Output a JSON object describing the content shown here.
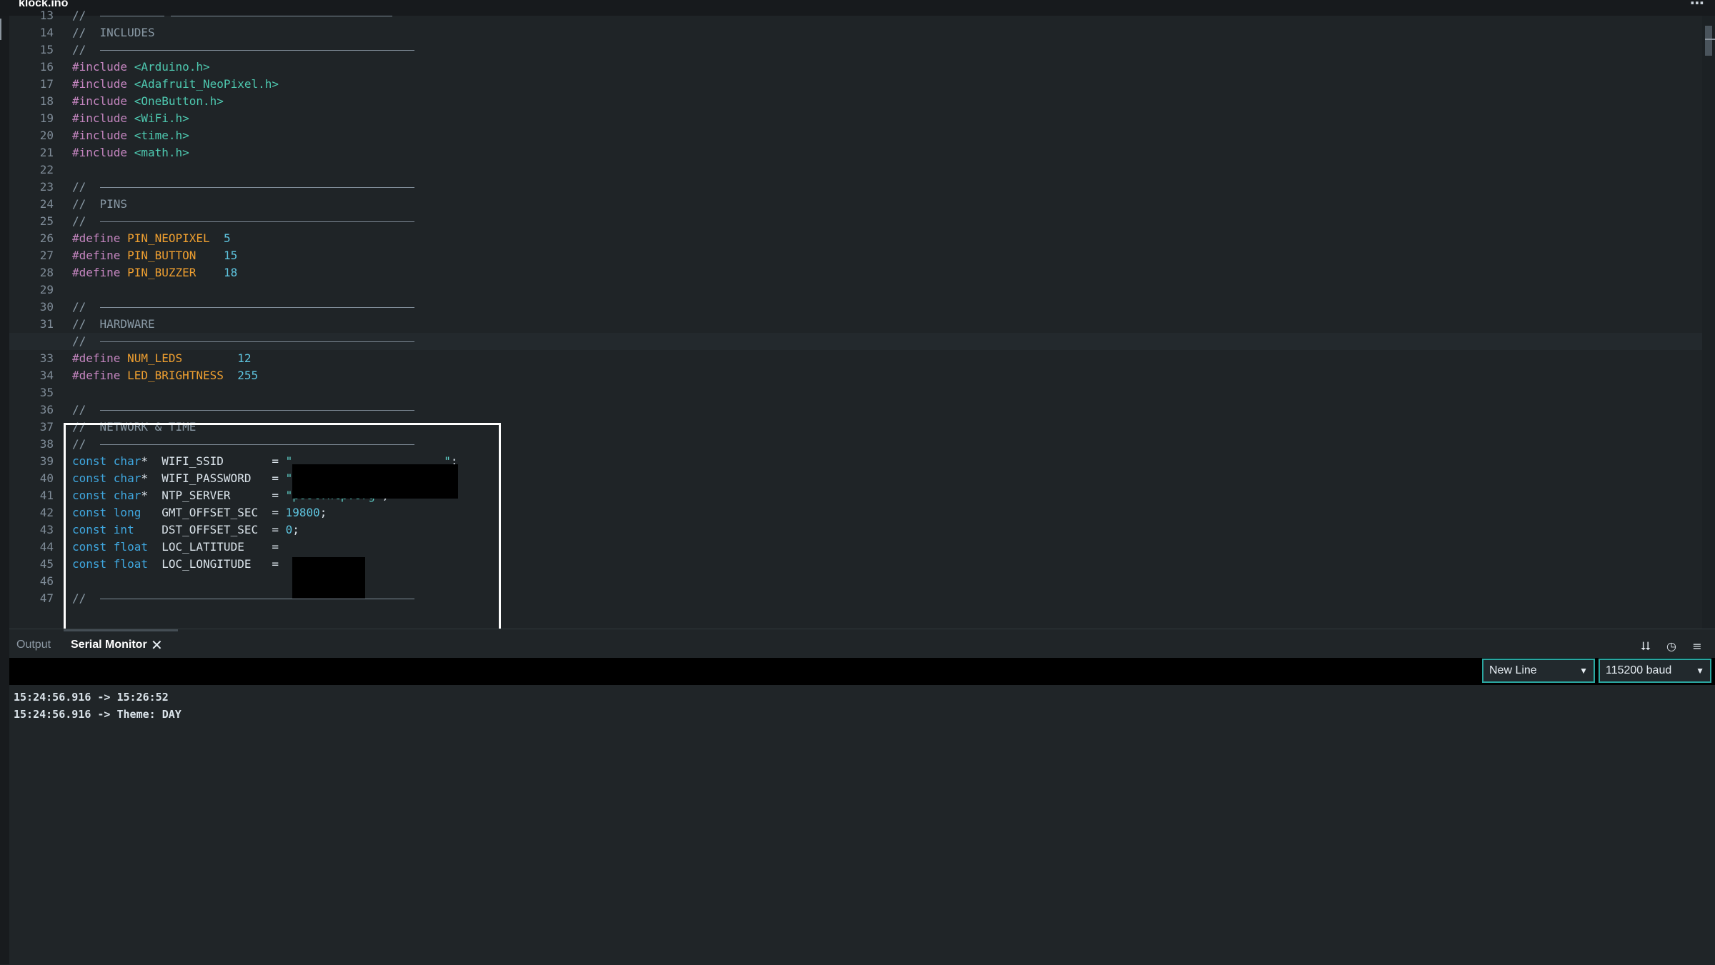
{
  "window": {
    "file_tab": "klock.ino",
    "more_icon": "ellipsis-icon"
  },
  "editor": {
    "active_line": 32,
    "lines": [
      {
        "n": "13",
        "parts": [
          [
            "cmt",
            "//  "
          ],
          [
            "rule",
            90
          ],
          [
            "plain",
            " "
          ],
          [
            "rule",
            310
          ]
        ]
      },
      {
        "n": "14",
        "parts": [
          [
            "cmt",
            "//  INCLUDES"
          ]
        ]
      },
      {
        "n": "15",
        "parts": [
          [
            "cmt",
            "//  "
          ],
          [
            "rule",
            440
          ]
        ]
      },
      {
        "n": "16",
        "parts": [
          [
            "dir",
            "#include"
          ],
          [
            "plain",
            " "
          ],
          [
            "lib",
            "<Arduino.h>"
          ]
        ]
      },
      {
        "n": "17",
        "parts": [
          [
            "dir",
            "#include"
          ],
          [
            "plain",
            " "
          ],
          [
            "lib",
            "<Adafruit_NeoPixel.h>"
          ]
        ]
      },
      {
        "n": "18",
        "parts": [
          [
            "dir",
            "#include"
          ],
          [
            "plain",
            " "
          ],
          [
            "lib",
            "<OneButton.h>"
          ]
        ]
      },
      {
        "n": "19",
        "parts": [
          [
            "dir",
            "#include"
          ],
          [
            "plain",
            " "
          ],
          [
            "lib",
            "<WiFi.h>"
          ]
        ]
      },
      {
        "n": "20",
        "parts": [
          [
            "dir",
            "#include"
          ],
          [
            "plain",
            " "
          ],
          [
            "lib",
            "<time.h>"
          ]
        ]
      },
      {
        "n": "21",
        "parts": [
          [
            "dir",
            "#include"
          ],
          [
            "plain",
            " "
          ],
          [
            "lib",
            "<math.h>"
          ]
        ]
      },
      {
        "n": "22",
        "parts": []
      },
      {
        "n": "23",
        "parts": [
          [
            "cmt",
            "//  "
          ],
          [
            "rule",
            440
          ]
        ]
      },
      {
        "n": "24",
        "parts": [
          [
            "cmt",
            "//  PINS"
          ]
        ]
      },
      {
        "n": "25",
        "parts": [
          [
            "cmt",
            "//  "
          ],
          [
            "rule",
            440
          ]
        ]
      },
      {
        "n": "26",
        "parts": [
          [
            "dir",
            "#define"
          ],
          [
            "plain",
            " "
          ],
          [
            "macro",
            "PIN_NEOPIXEL"
          ],
          [
            "plain",
            "  "
          ],
          [
            "num",
            "5"
          ]
        ]
      },
      {
        "n": "27",
        "parts": [
          [
            "dir",
            "#define"
          ],
          [
            "plain",
            " "
          ],
          [
            "macro",
            "PIN_BUTTON"
          ],
          [
            "plain",
            "    "
          ],
          [
            "num",
            "15"
          ]
        ]
      },
      {
        "n": "28",
        "parts": [
          [
            "dir",
            "#define"
          ],
          [
            "plain",
            " "
          ],
          [
            "macro",
            "PIN_BUZZER"
          ],
          [
            "plain",
            "    "
          ],
          [
            "num",
            "18"
          ]
        ]
      },
      {
        "n": "29",
        "parts": []
      },
      {
        "n": "30",
        "parts": [
          [
            "cmt",
            "//  "
          ],
          [
            "rule",
            440
          ]
        ]
      },
      {
        "n": "31",
        "parts": [
          [
            "cmt",
            "//  HARDWARE"
          ]
        ]
      },
      {
        "n": "32",
        "parts": [
          [
            "cmt",
            "//  "
          ],
          [
            "rule",
            440
          ]
        ]
      },
      {
        "n": "33",
        "parts": [
          [
            "dir",
            "#define"
          ],
          [
            "plain",
            " "
          ],
          [
            "macro",
            "NUM_LEDS"
          ],
          [
            "plain",
            "        "
          ],
          [
            "num",
            "12"
          ]
        ]
      },
      {
        "n": "34",
        "parts": [
          [
            "dir",
            "#define"
          ],
          [
            "plain",
            " "
          ],
          [
            "macro",
            "LED_BRIGHTNESS"
          ],
          [
            "plain",
            "  "
          ],
          [
            "num",
            "255"
          ]
        ]
      },
      {
        "n": "35",
        "parts": []
      },
      {
        "n": "36",
        "parts": [
          [
            "cmt",
            "//  "
          ],
          [
            "rule",
            440
          ]
        ]
      },
      {
        "n": "37",
        "parts": [
          [
            "cmt",
            "//  NETWORK & TIME"
          ]
        ]
      },
      {
        "n": "38",
        "parts": [
          [
            "cmt",
            "//  "
          ],
          [
            "rule",
            440
          ]
        ]
      },
      {
        "n": "39",
        "parts": [
          [
            "kw",
            "const char"
          ],
          [
            "plain",
            "*  WIFI_SSID       = "
          ],
          [
            "str",
            "\""
          ],
          [
            "plain",
            "                      "
          ],
          [
            "str",
            "\""
          ],
          [
            "plain",
            ";"
          ]
        ]
      },
      {
        "n": "40",
        "parts": [
          [
            "kw",
            "const char"
          ],
          [
            "plain",
            "*  WIFI_PASSWORD   = "
          ],
          [
            "str",
            "\""
          ]
        ]
      },
      {
        "n": "41",
        "parts": [
          [
            "kw",
            "const char"
          ],
          [
            "plain",
            "*  NTP_SERVER      = "
          ],
          [
            "str",
            "\"pool.ntp.org\""
          ],
          [
            "plain",
            ";"
          ]
        ]
      },
      {
        "n": "42",
        "parts": [
          [
            "kw",
            "const long"
          ],
          [
            "plain",
            "   GMT_OFFSET_SEC  = "
          ],
          [
            "num",
            "19800"
          ],
          [
            "plain",
            ";"
          ]
        ]
      },
      {
        "n": "43",
        "parts": [
          [
            "kw",
            "const int"
          ],
          [
            "plain",
            "    DST_OFFSET_SEC  = "
          ],
          [
            "num",
            "0"
          ],
          [
            "plain",
            ";"
          ]
        ]
      },
      {
        "n": "44",
        "parts": [
          [
            "kw",
            "const float"
          ],
          [
            "plain",
            "  LOC_LATITUDE    = "
          ]
        ]
      },
      {
        "n": "45",
        "parts": [
          [
            "kw",
            "const float"
          ],
          [
            "plain",
            "  LOC_LONGITUDE   = "
          ]
        ]
      },
      {
        "n": "46",
        "parts": []
      },
      {
        "n": "47",
        "parts": [
          [
            "cmt",
            "//  "
          ],
          [
            "rule",
            440
          ]
        ]
      }
    ]
  },
  "panel": {
    "tabs": {
      "output": "Output",
      "serial": "Serial Monitor"
    },
    "close_glyph": "✕",
    "icons": {
      "scroll": "⮇",
      "clock": "◷",
      "menu": "≡"
    },
    "line_ending": "New Line",
    "baud": "115200 baud",
    "serial_lines": [
      "15:24:56.916 -> 15:26:52",
      "15:24:56.916 -> Theme: DAY"
    ]
  },
  "colors": {
    "accent": "#2aa6a0",
    "background": "#1f2427"
  }
}
